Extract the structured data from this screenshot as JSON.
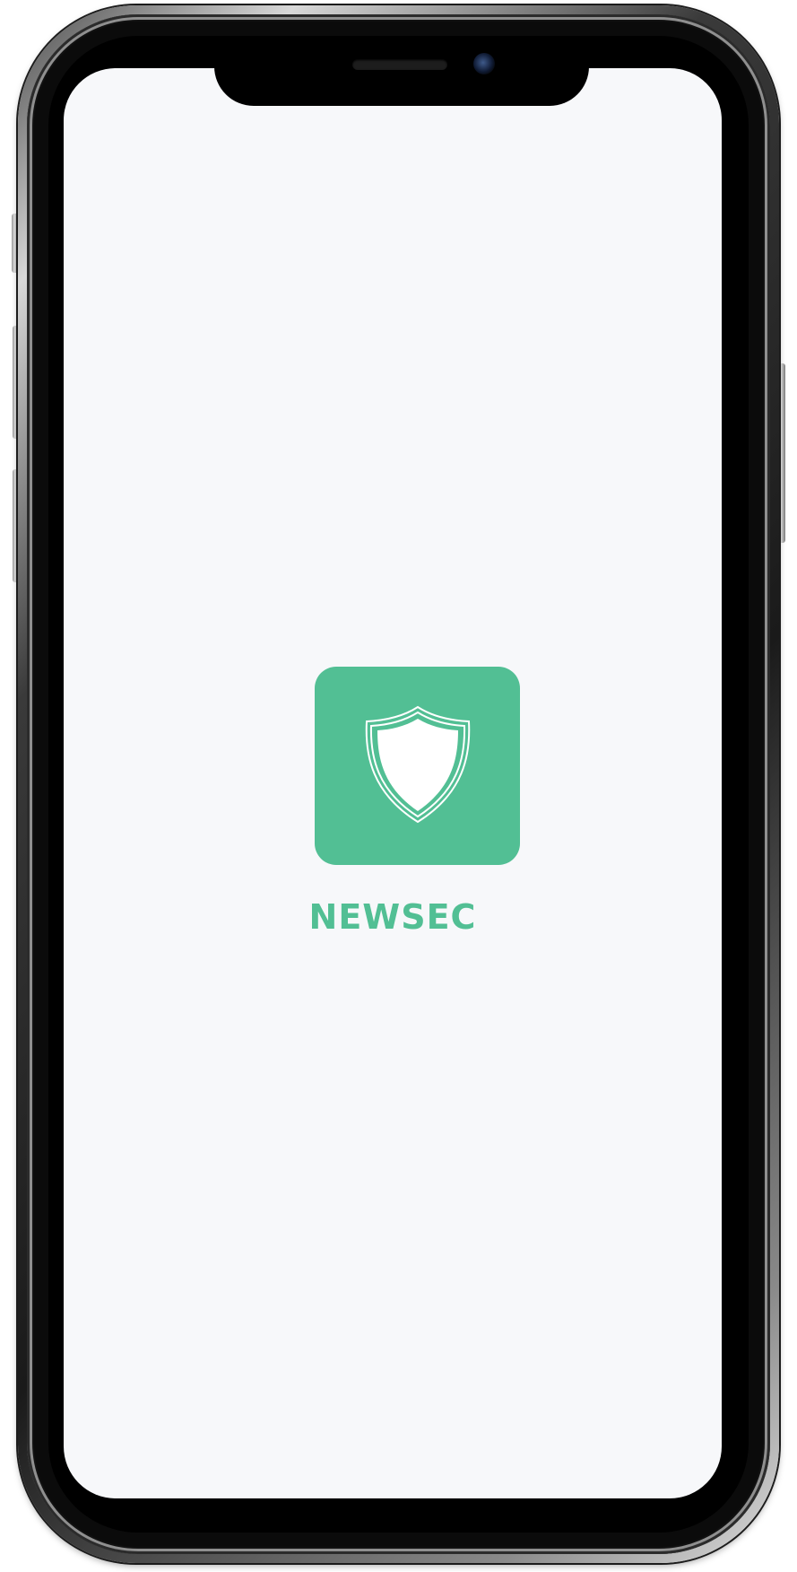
{
  "app": {
    "name": "NEWSEC"
  },
  "colors": {
    "brand": "#52bf94",
    "screen_background": "#f7f8fa",
    "shield_fill": "#ffffff"
  },
  "icons": {
    "logo": "shield-icon"
  }
}
